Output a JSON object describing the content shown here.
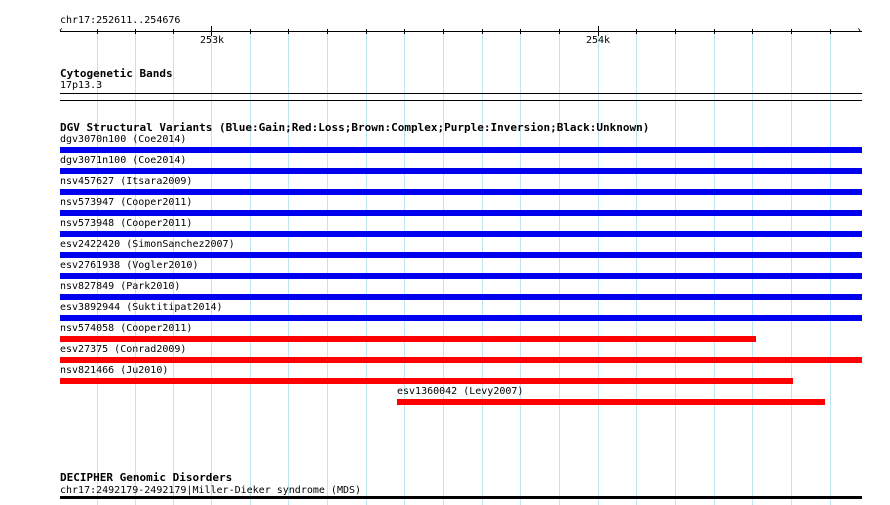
{
  "ruler": {
    "position": "chr17:252611..254676",
    "ticks": [
      "253k",
      "254k"
    ]
  },
  "cytogenetic": {
    "title": "Cytogenetic Bands",
    "band": "17p13.3"
  },
  "dgv": {
    "title": "DGV Structural Variants (Blue:Gain;Red:Loss;Brown:Complex;Purple:Inversion;Black:Unknown)",
    "colors": {
      "gain": "#0000ee",
      "loss": "#ff0000"
    },
    "variants": [
      {
        "label": "dgv3070n100 (Coe2014)",
        "type": "gain"
      },
      {
        "label": "dgv3071n100 (Coe2014)",
        "type": "gain"
      },
      {
        "label": "nsv457627 (Itsara2009)",
        "type": "gain"
      },
      {
        "label": "nsv573947 (Cooper2011)",
        "type": "gain"
      },
      {
        "label": "nsv573948 (Cooper2011)",
        "type": "gain"
      },
      {
        "label": "esv2422420 (SimonSanchez2007)",
        "type": "gain"
      },
      {
        "label": "esv2761938 (Vogler2010)",
        "type": "gain"
      },
      {
        "label": "nsv827849 (Park2010)",
        "type": "gain"
      },
      {
        "label": "esv3892944 (Suktitipat2014)",
        "type": "gain"
      },
      {
        "label": "nsv574058 (Cooper2011)",
        "type": "loss"
      },
      {
        "label": "esv27375 (Conrad2009)",
        "type": "loss"
      },
      {
        "label": "nsv821466 (Ju2010)",
        "type": "loss"
      },
      {
        "label": "esv1360042 (Levy2007)",
        "type": "loss"
      }
    ]
  },
  "decipher": {
    "title": "DECIPHER Genomic Disorders",
    "entry": "chr17:2492179-2492179|Miller-Dieker syndrome (MDS)"
  }
}
